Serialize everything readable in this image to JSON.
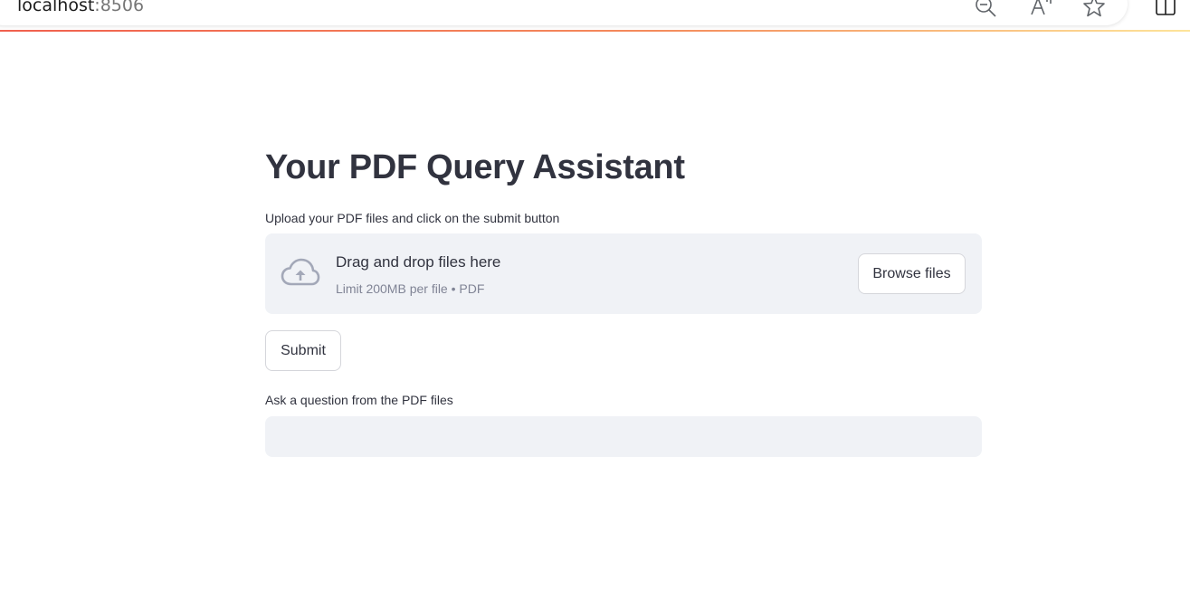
{
  "browser": {
    "url_host": "localhost",
    "url_port": ":8506"
  },
  "app": {
    "title": "Your PDF Query Assistant",
    "upload": {
      "label": "Upload your PDF files and click on the submit button",
      "drop_title": "Drag and drop files here",
      "drop_subtitle": "Limit 200MB per file • PDF",
      "browse_label": "Browse files"
    },
    "submit_label": "Submit",
    "question": {
      "label": "Ask a question from the PDF files",
      "value": "",
      "placeholder": ""
    }
  },
  "icons": {
    "zoom_out": "zoom-out-icon",
    "read_aloud": "read-aloud-icon",
    "favorite": "star-icon",
    "split_screen": "split-screen-icon",
    "upload": "cloud-upload-icon"
  },
  "colors": {
    "text": "#31333f",
    "muted": "#808495",
    "surface": "#f0f2f6",
    "border": "#d5d6db",
    "icon": "#a3a8b8",
    "accent_line_start": "#f0604e",
    "accent_line_end": "#fde49a"
  }
}
